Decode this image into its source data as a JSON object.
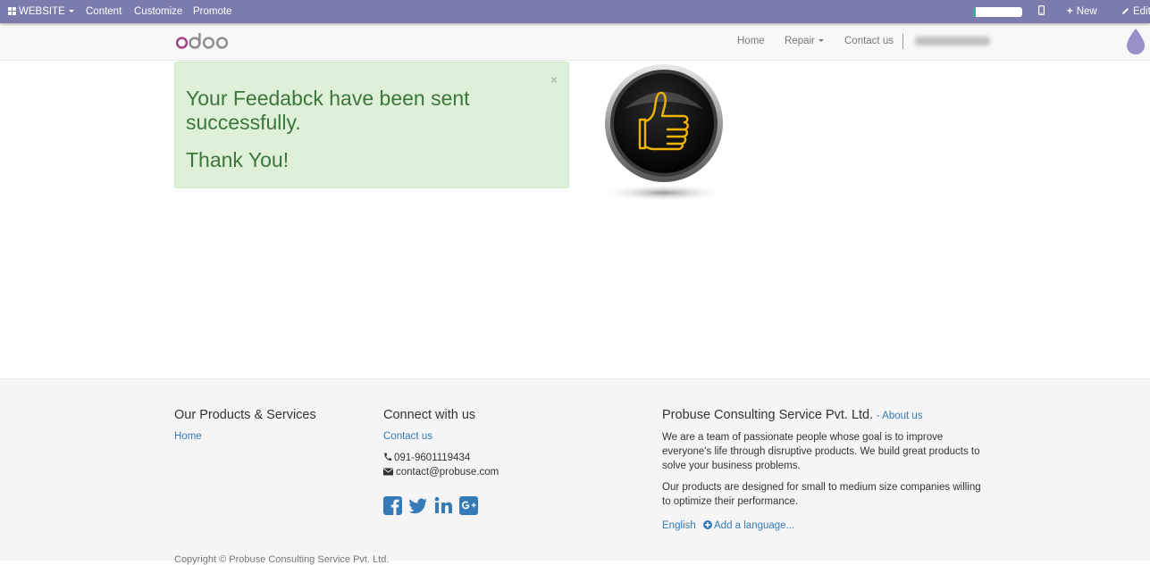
{
  "admin_bar": {
    "website_label": "WEBSITE",
    "content_label": "Content",
    "customize_label": "Customize",
    "promote_label": "Promote",
    "progress_fraction": 0.05,
    "new_label": "New",
    "edit_label": "Edit",
    "colors": {
      "background": "#7c7bad",
      "progress": "#21b799"
    }
  },
  "navbar": {
    "logo_text": "odoo",
    "links": [
      "Home",
      "Repair",
      "Contact us"
    ]
  },
  "alert": {
    "close_symbol": "×",
    "message": "Your Feedabck have been sent successfully.",
    "thanks": "Thank You!",
    "colors": {
      "background": "#dff0d8",
      "text": "#3c763d"
    }
  },
  "footer": {
    "products_heading": "Our Products & Services",
    "products_links": [
      "Home"
    ],
    "connect_heading": "Connect with us",
    "connect_link": "Contact us",
    "phone": "091-9601119434",
    "email": "contact@probuse.com",
    "social_icons": [
      "facebook-icon",
      "twitter-icon",
      "linkedin-icon",
      "google-plus-icon"
    ],
    "company_name": "Probuse Consulting Service Pvt. Ltd.",
    "about_link": "- About us",
    "about_para1": "We are a team of passionate people whose goal is to improve everyone's life through disruptive products. We build great products to solve your business problems.",
    "about_para2": "Our products are designed for small to medium size companies willing to optimize their performance.",
    "language": "English",
    "add_language": "Add a language...",
    "copyright": "Copyright © Probuse Consulting Service Pvt. Ltd."
  }
}
